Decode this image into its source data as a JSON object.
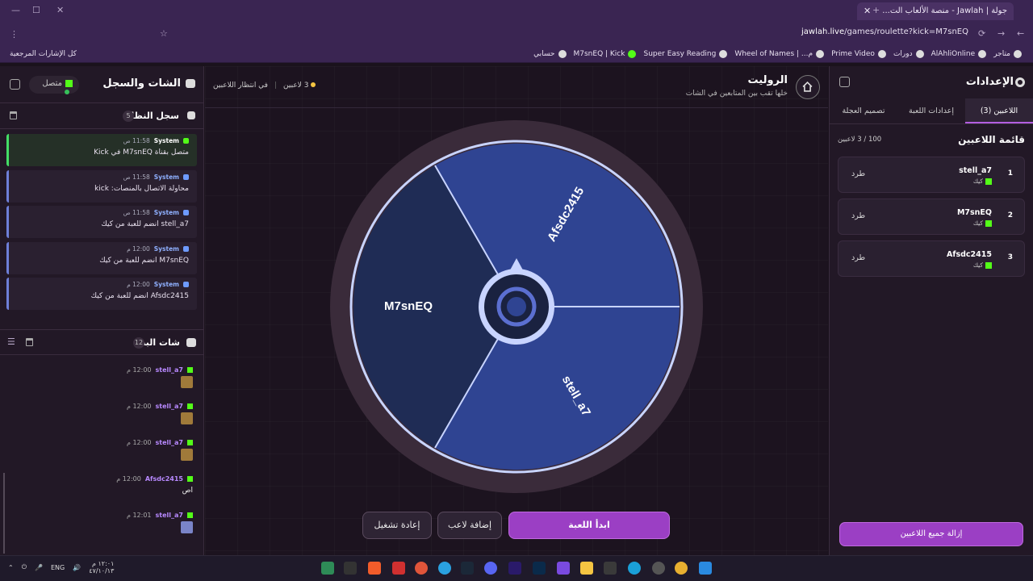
{
  "browser": {
    "tab_title": "جولة | Jawlah - منصة الألعاب الت...",
    "url_host": "jawlah.live",
    "url_path": "/games/roulette?kick=M7snEQ",
    "bookmarks": [
      "متاجر",
      "AlAhliOnline",
      "دورات",
      "Prime Video",
      "م... | Wheel of Names",
      "Super Easy Reading",
      "M7snEQ | Kick",
      "حسابي"
    ],
    "all_bookmarks": "كل الإشارات المرجعية"
  },
  "chat_panel": {
    "title": "الشات والسجل",
    "status": "متصل",
    "system_log_title": "سجل النظام",
    "system_log_count": "5",
    "logs": [
      {
        "sender": "System",
        "time": "11:58 ص",
        "message": "متصل بقناة M7snEQ في Kick",
        "type": "ok"
      },
      {
        "sender": "System",
        "time": "11:58 ص",
        "message": "محاولة الاتصال بالمنصات: kick",
        "type": "info"
      },
      {
        "sender": "System",
        "time": "11:58 ص",
        "message": "stell_a7 انضم للعبة من كيك",
        "type": "info"
      },
      {
        "sender": "System",
        "time": "12:00 م",
        "message": "M7snEQ انضم للعبة من كيك",
        "type": "info"
      },
      {
        "sender": "System",
        "time": "12:00 م",
        "message": "Afsdc2415 انضم للعبة من كيك",
        "type": "info"
      }
    ],
    "stream_chat_title": "شات البث",
    "stream_chat_count": "12",
    "messages": [
      {
        "user": "stell_a7",
        "time": "12:00 م",
        "text": ""
      },
      {
        "user": "stell_a7",
        "time": "12:00 م",
        "text": ""
      },
      {
        "user": "stell_a7",
        "time": "12:00 م",
        "text": ""
      },
      {
        "user": "Afsdc2415",
        "time": "12:00 م",
        "text": "اص"
      },
      {
        "user": "stell_a7",
        "time": "12:01 م",
        "text": ""
      }
    ]
  },
  "game": {
    "title": "الروليت",
    "subtitle": "خلها تقب بين المتابعين في الشات",
    "players_status": "3 لاعبين",
    "waiting_status": "في انتظار اللاعبين",
    "wheel_segments": [
      "Afsdc2415",
      "stell_a7",
      "M7snEQ"
    ],
    "start_button": "ابدأ اللعبة",
    "add_player_button": "إضافة لاعب",
    "restart_button": "إعادة تشغيل"
  },
  "settings": {
    "title": "الإعدادات",
    "tabs": [
      "اللاعبين (3)",
      "إعدادات اللعبة",
      "تصميم العجلة"
    ],
    "list_title": "قائمة اللاعبين",
    "list_count": "100 / 3 لاعبين",
    "players": [
      {
        "index": "1",
        "name": "stell_a7",
        "platform": "كيك",
        "action": "طرد"
      },
      {
        "index": "2",
        "name": "M7snEQ",
        "platform": "كيك",
        "action": "طرد"
      },
      {
        "index": "3",
        "name": "Afsdc2415",
        "platform": "كيك",
        "action": "طرد"
      }
    ],
    "remove_all": "إزالة جميع اللاعبين"
  },
  "taskbar": {
    "time": "١٢:٠١ م",
    "date": "٤٧/١٠/١٣",
    "lang": "ENG"
  }
}
